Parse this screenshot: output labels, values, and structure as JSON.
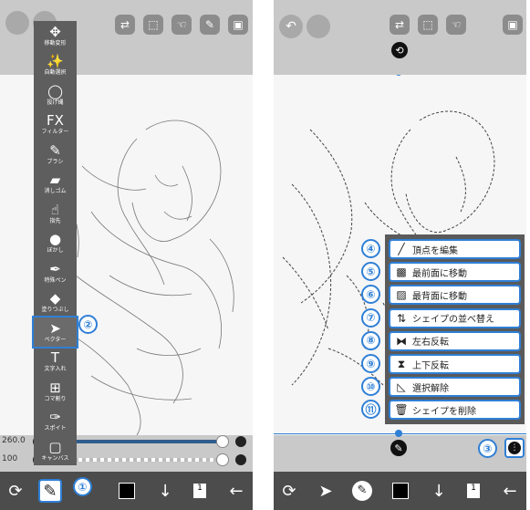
{
  "left": {
    "tools": [
      {
        "label": "移動変形",
        "icon": "move-icon",
        "glyph": "✥"
      },
      {
        "label": "自動選択",
        "icon": "magic-wand-icon",
        "glyph": "✨"
      },
      {
        "label": "投げ縄",
        "icon": "lasso-icon",
        "glyph": "◯"
      },
      {
        "label": "フィルター",
        "icon": "filter-icon",
        "glyph": "FX"
      },
      {
        "label": "ブラシ",
        "icon": "brush-icon",
        "glyph": "✎"
      },
      {
        "label": "消しゴム",
        "icon": "eraser-icon",
        "glyph": "▰"
      },
      {
        "label": "指先",
        "icon": "finger-icon",
        "glyph": "☝"
      },
      {
        "label": "ぼかし",
        "icon": "blur-icon",
        "glyph": "●"
      },
      {
        "label": "特殊ペン",
        "icon": "special-pen-icon",
        "glyph": "✒"
      },
      {
        "label": "塗りつぶし",
        "icon": "fill-icon",
        "glyph": "◆"
      },
      {
        "label": "ベクター",
        "icon": "vector-icon",
        "glyph": "➤"
      },
      {
        "label": "文字入れ",
        "icon": "text-icon",
        "glyph": "T"
      },
      {
        "label": "コマ割り",
        "icon": "frame-divider-icon",
        "glyph": "⊞"
      },
      {
        "label": "スポイト",
        "icon": "eyedropper-icon",
        "glyph": "✑"
      },
      {
        "label": "キャンバス",
        "icon": "canvas-icon",
        "glyph": "▢"
      }
    ],
    "selected_tool_index": 10,
    "slider_size": "260.0",
    "slider_opacity": "100",
    "callout_tool": "②",
    "callout_brush": "①"
  },
  "right": {
    "callout_menu": "③",
    "menu_items": [
      {
        "label": "頂点を編集",
        "num": "④",
        "icon": "edit-vertex-icon",
        "glyph": "╱"
      },
      {
        "label": "最前面に移動",
        "num": "⑤",
        "icon": "bring-front-icon",
        "glyph": "▩"
      },
      {
        "label": "最背面に移動",
        "num": "⑥",
        "icon": "send-back-icon",
        "glyph": "▨"
      },
      {
        "label": "シェイプの並べ替え",
        "num": "⑦",
        "icon": "reorder-icon",
        "glyph": "⇅"
      },
      {
        "label": "左右反転",
        "num": "⑧",
        "icon": "flip-horizontal-icon",
        "glyph": "⧓"
      },
      {
        "label": "上下反転",
        "num": "⑨",
        "icon": "flip-vertical-icon",
        "glyph": "⧗"
      },
      {
        "label": "選択解除",
        "num": "⑩",
        "icon": "deselect-icon",
        "glyph": "◺"
      },
      {
        "label": "シェイプを削除",
        "num": "⑪",
        "icon": "delete-shape-icon",
        "glyph": "🗑"
      }
    ]
  },
  "bottom": {
    "layer_badge": "1"
  },
  "colors": {
    "accent": "#2f7fd6",
    "toolbar": "#5e5e5e",
    "bottom_bar": "#4c4c4c",
    "top_bar": "#c9c9c9"
  }
}
